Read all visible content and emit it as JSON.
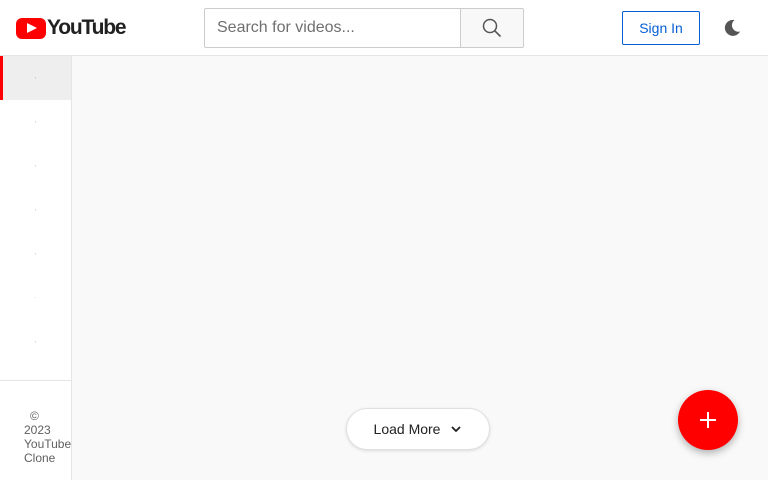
{
  "header": {
    "logo_text": "YouTube",
    "search": {
      "placeholder": "Search for videos...",
      "value": "",
      "icon": "search-icon"
    },
    "signin_label": "Sign In",
    "theme_toggle_icon": "moon-icon"
  },
  "sidebar": {
    "items": [
      {
        "glyph": "◦",
        "active": true
      },
      {
        "glyph": "◦",
        "active": false
      },
      {
        "glyph": "◦",
        "active": false
      },
      {
        "glyph": "◦",
        "active": false
      },
      {
        "glyph": "◦",
        "active": false
      },
      {
        "glyph": "·",
        "active": false
      },
      {
        "glyph": "◦",
        "active": false
      }
    ],
    "copyright_symbol": "©",
    "copyright_year": "2023",
    "copyright_name_1": "YouTube",
    "copyright_name_2": "Clone"
  },
  "main": {
    "load_more_label": "Load More",
    "load_more_icon": "chevron-down-icon",
    "fab_icon": "plus-icon"
  },
  "colors": {
    "brand_red": "#ff0000",
    "link_blue": "#065fd4",
    "background": "#f9f9f9"
  }
}
